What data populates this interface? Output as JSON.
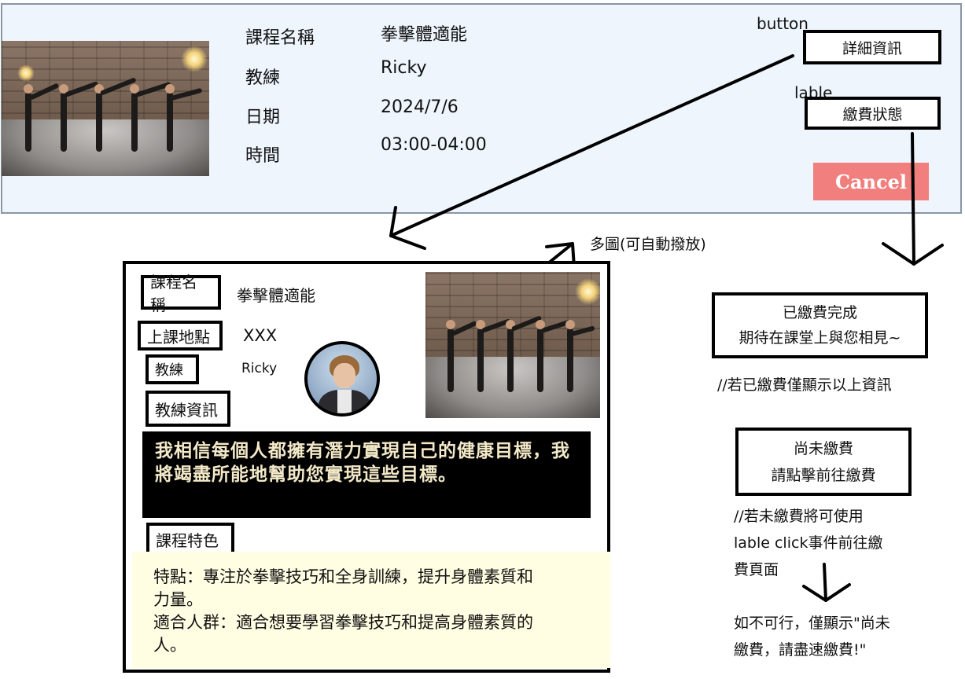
{
  "card": {
    "fields": [
      {
        "key": "課程名稱",
        "value": "拳擊體適能"
      },
      {
        "key": "教練",
        "value": "Ricky"
      },
      {
        "key": "日期",
        "value": "2024/7/6"
      },
      {
        "key": "時間",
        "value": "03:00-04:00"
      }
    ],
    "button_caption": "button",
    "detail_button": "詳細資訊",
    "label_caption": "lable",
    "payment_status": "繳費狀態",
    "cancel": "Cancel"
  },
  "popup": {
    "multi_image_note": "多圖(可自動撥放)",
    "course_name_tag": "課程名稱",
    "course_name": "拳擊體適能",
    "location_tag": "上課地點",
    "location": "XXX",
    "coach_tag": "教練",
    "coach": "Ricky",
    "coach_info_tag": "教練資訊",
    "coach_intro": "我相信每個人都擁有潛力實現自己的健康目標，我將竭盡所能地幫助您實現這些目標。",
    "features_tag": "課程特色",
    "features_line1": "特點：專注於拳擊技巧和全身訓練，提升身體素質和",
    "features_line2": "力量。",
    "features_line3": "適合人群：適合想要學習拳擊技巧和提高身體素質的",
    "features_line4": "人。"
  },
  "flow": {
    "paid_line1": "已繳費完成",
    "paid_line2": "期待在課堂上與您相見~",
    "paid_note": "//若已繳費僅顯示以上資訊",
    "unpaid_line1": "尚未繳費",
    "unpaid_line2": "請點擊前往繳費",
    "unpaid_note1": "//若未繳費將可使用",
    "unpaid_note2": "lable click事件前往繳",
    "unpaid_note3": "費頁面",
    "fallback1": "如不可行，僅顯示\"尚未",
    "fallback2": "繳費，請盡速繳費!\""
  }
}
